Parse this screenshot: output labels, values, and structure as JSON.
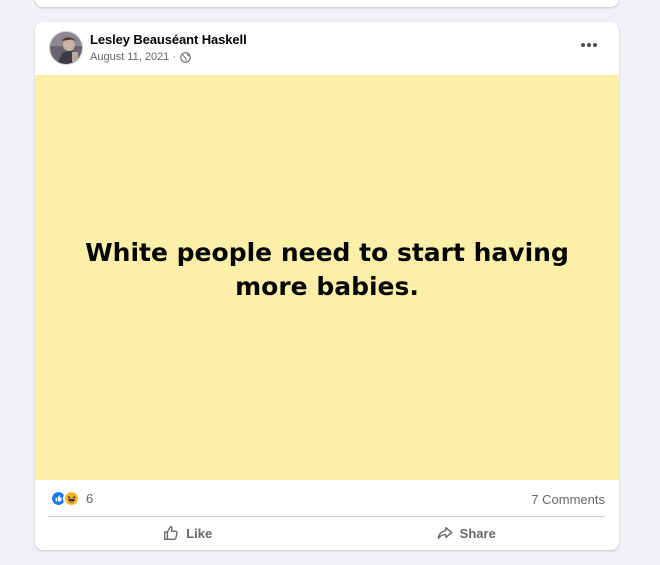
{
  "post": {
    "author": "Lesley Beauséant Haskell",
    "date": "August 11, 2021",
    "separator": "·",
    "privacy_icon": "globe-icon",
    "text": "White people need to start having more babies.",
    "background_color": "#fbefa9",
    "reactions": {
      "icons": [
        "like-reaction-icon",
        "haha-reaction-icon"
      ],
      "count": "6"
    },
    "comments": "7 Comments",
    "actions": {
      "like_label": "Like",
      "share_label": "Share"
    }
  },
  "colors": {
    "page_background": "#f0f2f5",
    "secondary_text": "#65676b",
    "like_blue": "#1877f2",
    "haha_yellow": "#f7b125"
  }
}
